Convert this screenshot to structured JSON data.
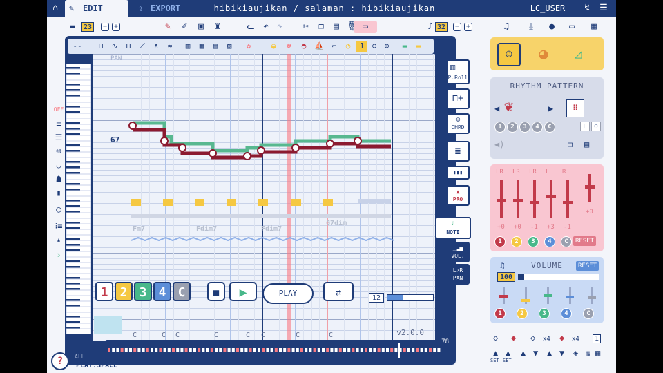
{
  "topbar": {
    "tab_edit": "EDIT",
    "tab_export": "EXPORT",
    "project_title": "hibikiaujikan / salaman : hibikiaujikan",
    "user": "LC_USER"
  },
  "toolbar": {
    "song_number": "23",
    "beats_per_bar": "32"
  },
  "editor": {
    "pan_label": "PAN",
    "selected_note_value": "67",
    "octave_labels": [
      "C7",
      "C6",
      "C5",
      "C4",
      "C3",
      "C2",
      "C1"
    ],
    "chords": [
      "Fm7",
      "Fdim7",
      "Fdim7",
      "G7dim"
    ],
    "version": "v2.0.0",
    "channel_marks": [
      "C",
      "C",
      "C",
      "C",
      "C",
      "C",
      "C",
      "C"
    ],
    "left_status": "OFF"
  },
  "tracks": {
    "labels": [
      "1",
      "2",
      "3",
      "4",
      "C"
    ],
    "colors": [
      "#c23a4a",
      "#f5c842",
      "#48b88a",
      "#5c8ed8",
      "#9aa0b0"
    ],
    "play_label": "PLAY",
    "tempo_value": "12",
    "total_bars": "78",
    "all_label": "ALL",
    "play_hint": "PLAY:SPACE"
  },
  "right_tools": {
    "piano_roll": "P.Roll",
    "chord": "CHRD",
    "pro": "PRO",
    "note": "NOTE",
    "volume": "VOL.",
    "pan": "PAN"
  },
  "rhythm": {
    "title": "RHYTHM PATTERN",
    "slots": [
      "1",
      "2",
      "3",
      "4",
      "C"
    ],
    "lo_labels": [
      "L",
      "O"
    ]
  },
  "mix": {
    "channel_labels": [
      "LR",
      "LR",
      "LR",
      "L",
      "R"
    ],
    "values": [
      "+0",
      "+0",
      "-1",
      "+3",
      "-1"
    ],
    "master_value": "+0",
    "levels": [
      0.5,
      0.5,
      0.45,
      0.6,
      0.45
    ],
    "slots": [
      "1",
      "2",
      "3",
      "4",
      "C"
    ],
    "reset": "RESET"
  },
  "volume": {
    "title": "VOLUME",
    "reset": "RESET",
    "value": "100",
    "slots": [
      "1",
      "2",
      "3",
      "4",
      "C"
    ],
    "levels": [
      0.55,
      0.3,
      0.6,
      0.5,
      0.45
    ]
  },
  "bottom": {
    "multipliers": [
      "x4",
      "x4",
      "1"
    ],
    "set_labels": [
      "SET",
      "SET"
    ]
  },
  "colors": {
    "navy": "#1f3c78",
    "melody_red": "#8c1a30",
    "melody_green": "#58b890",
    "playhead": "#f87a82",
    "beat_line": "#f0a0a8"
  }
}
